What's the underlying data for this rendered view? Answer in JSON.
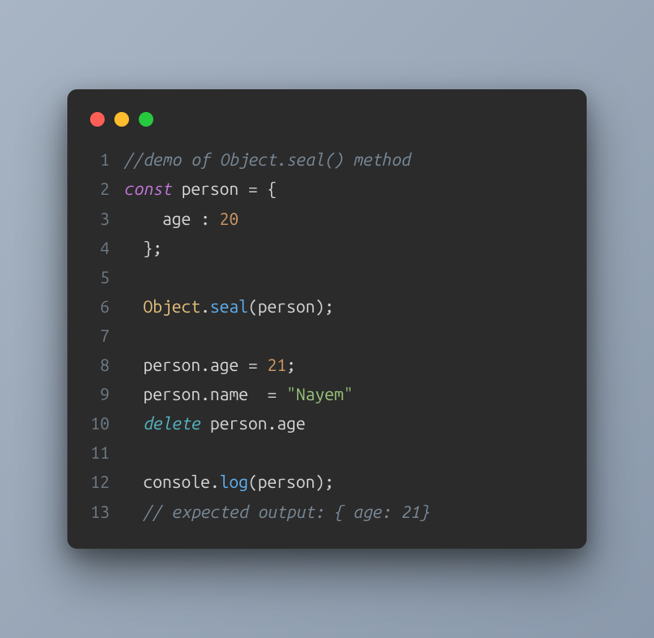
{
  "window": {
    "dots": [
      "red",
      "yellow",
      "green"
    ]
  },
  "code": {
    "lines": [
      {
        "n": "1",
        "tokens": [
          {
            "cls": "tk-comment",
            "t": "//demo of Object.seal() method"
          }
        ]
      },
      {
        "n": "2",
        "tokens": [
          {
            "cls": "tk-keyword",
            "t": "const"
          },
          {
            "cls": "tk-ident",
            "t": " person "
          },
          {
            "cls": "tk-punct",
            "t": "= {"
          }
        ]
      },
      {
        "n": "3",
        "tokens": [
          {
            "cls": "tk-ident",
            "t": "    age "
          },
          {
            "cls": "tk-punct",
            "t": ": "
          },
          {
            "cls": "tk-num",
            "t": "20"
          }
        ]
      },
      {
        "n": "4",
        "tokens": [
          {
            "cls": "tk-punct",
            "t": "  };"
          }
        ]
      },
      {
        "n": "5",
        "tokens": []
      },
      {
        "n": "6",
        "tokens": [
          {
            "cls": "tk-ident",
            "t": "  "
          },
          {
            "cls": "tk-obj",
            "t": "Object"
          },
          {
            "cls": "tk-dot",
            "t": "."
          },
          {
            "cls": "tk-call",
            "t": "seal"
          },
          {
            "cls": "tk-punct",
            "t": "(person);"
          }
        ]
      },
      {
        "n": "7",
        "tokens": []
      },
      {
        "n": "8",
        "tokens": [
          {
            "cls": "tk-ident",
            "t": "  person"
          },
          {
            "cls": "tk-dot",
            "t": "."
          },
          {
            "cls": "tk-prop",
            "t": "age "
          },
          {
            "cls": "tk-punct",
            "t": "= "
          },
          {
            "cls": "tk-num",
            "t": "21"
          },
          {
            "cls": "tk-punct",
            "t": ";"
          }
        ]
      },
      {
        "n": "9",
        "tokens": [
          {
            "cls": "tk-ident",
            "t": "  person"
          },
          {
            "cls": "tk-dot",
            "t": "."
          },
          {
            "cls": "tk-prop",
            "t": "name  "
          },
          {
            "cls": "tk-punct",
            "t": "= "
          },
          {
            "cls": "tk-str",
            "t": "\"Nayem\""
          }
        ]
      },
      {
        "n": "10",
        "tokens": [
          {
            "cls": "tk-ident",
            "t": "  "
          },
          {
            "cls": "tk-keyword2",
            "t": "delete"
          },
          {
            "cls": "tk-ident",
            "t": " person"
          },
          {
            "cls": "tk-dot",
            "t": "."
          },
          {
            "cls": "tk-prop",
            "t": "age"
          }
        ]
      },
      {
        "n": "11",
        "tokens": []
      },
      {
        "n": "12",
        "tokens": [
          {
            "cls": "tk-ident",
            "t": "  console"
          },
          {
            "cls": "tk-dot",
            "t": "."
          },
          {
            "cls": "tk-call",
            "t": "log"
          },
          {
            "cls": "tk-punct",
            "t": "(person);"
          }
        ]
      },
      {
        "n": "13",
        "tokens": [
          {
            "cls": "tk-ident",
            "t": "  "
          },
          {
            "cls": "tk-comment",
            "t": "// expected output: { age: 21}"
          }
        ]
      }
    ]
  }
}
